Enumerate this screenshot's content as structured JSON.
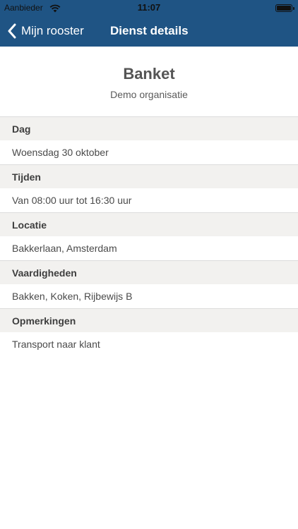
{
  "status_bar": {
    "carrier": "Aanbieder",
    "time": "11:07"
  },
  "nav": {
    "back_label": "Mijn rooster",
    "title": "Dienst details"
  },
  "header": {
    "title": "Banket",
    "subtitle": "Demo organisatie"
  },
  "sections": [
    {
      "label": "Dag",
      "value": "Woensdag 30 oktober"
    },
    {
      "label": "Tijden",
      "value": "Van 08:00 uur tot 16:30 uur"
    },
    {
      "label": "Locatie",
      "value": "Bakkerlaan, Amsterdam"
    },
    {
      "label": "Vaardigheden",
      "value": "Bakken, Koken, Rijbewijs B"
    },
    {
      "label": "Opmerkingen",
      "value": "Transport naar klant"
    }
  ],
  "colors": {
    "nav_background": "#1f5484",
    "section_header_background": "#f2f1ef"
  }
}
